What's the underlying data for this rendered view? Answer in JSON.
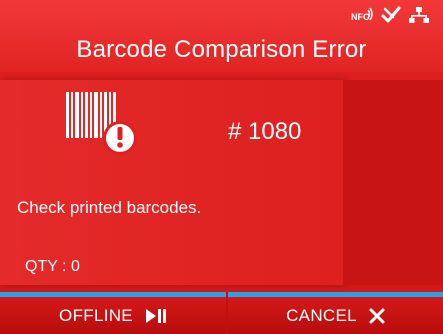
{
  "header": {
    "title": "Barcode Comparison Error",
    "status_icons": [
      "nfc-icon",
      "bluetooth-check-icon",
      "network-icon"
    ]
  },
  "message_card": {
    "icon": "barcode-error-icon",
    "error_number": "# 1080",
    "message": "Check printed barcodes.",
    "qty": "QTY : 0"
  },
  "softkeys": {
    "left_label": "OFFLINE",
    "left_icon": "play-pause-icon",
    "right_label": "CANCEL",
    "right_icon": "close-icon"
  },
  "colors": {
    "background": "#e02020",
    "softkey_accent": "#2aa3e6",
    "text": "#ffffff"
  }
}
